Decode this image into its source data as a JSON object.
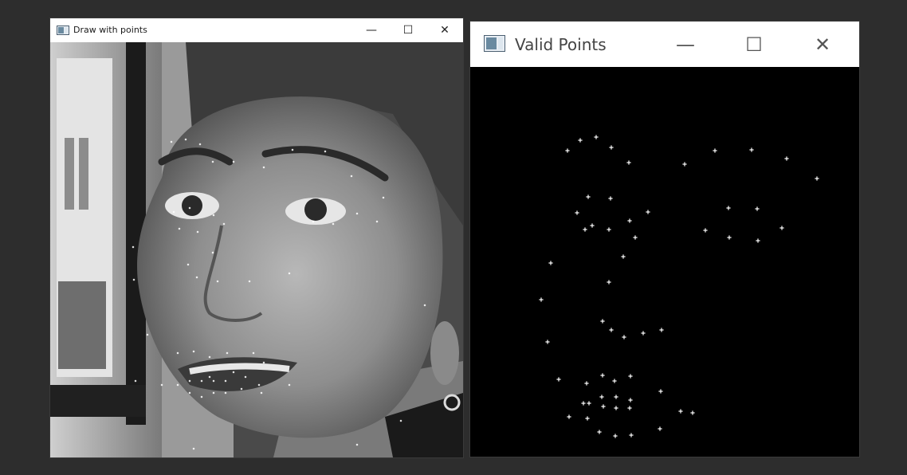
{
  "window_left": {
    "title": "Draw with points",
    "icon": "app-window-icon",
    "controls": {
      "minimize": "—",
      "maximize": "☐",
      "close": "✕"
    }
  },
  "window_right": {
    "title": "Valid Points",
    "icon": "app-window-icon",
    "controls": {
      "minimize": "—",
      "maximize": "☐",
      "close": "✕"
    }
  }
}
